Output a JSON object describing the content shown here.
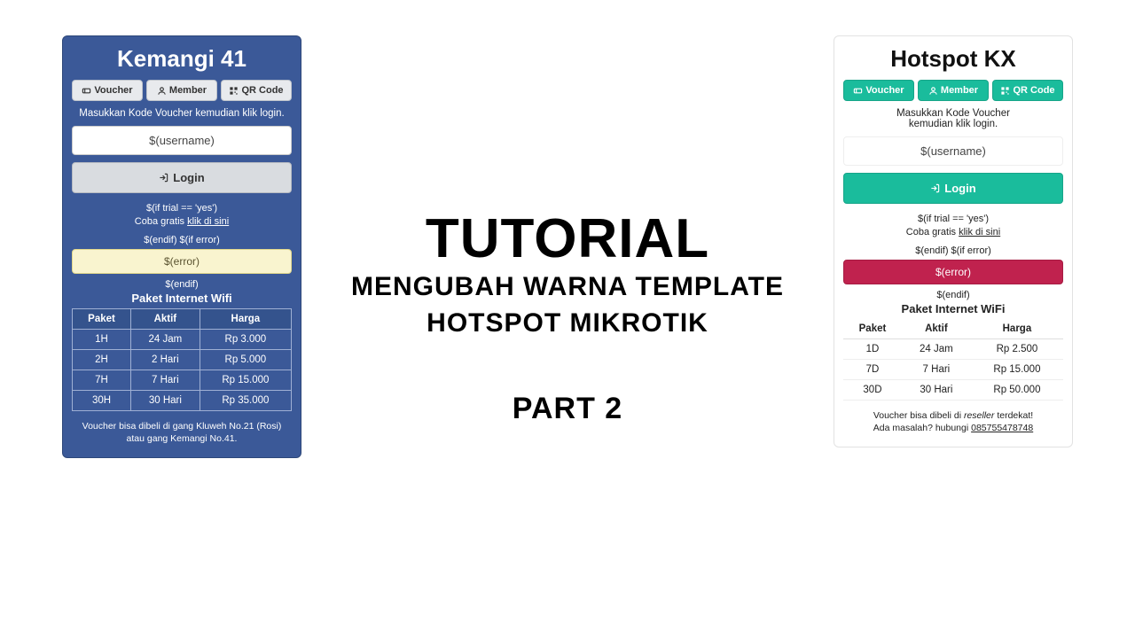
{
  "center": {
    "line1": "TUTORIAL",
    "line2a": "MENGUBAH WARNA TEMPLATE",
    "line2b": "HOTSPOT MIKROTIK",
    "line3": "PART 2"
  },
  "left": {
    "title": "Kemangi 41",
    "tabs": {
      "voucher": "Voucher",
      "member": "Member",
      "qrcode": "QR Code"
    },
    "instruction": "Masukkan Kode Voucher kemudian klik login.",
    "username_placeholder": "$(username)",
    "login": "Login",
    "trial_if": "$(if trial == 'yes')",
    "trial_text": "Coba gratis ",
    "trial_link": "klik di sini",
    "endif_iferror": "$(endif) $(if error)",
    "error": "$(error)",
    "endif": "$(endif)",
    "pkg_title": "Paket Internet Wifi",
    "pkg_headers": {
      "paket": "Paket",
      "aktif": "Aktif",
      "harga": "Harga"
    },
    "pkg_rows": [
      {
        "paket": "1H",
        "aktif": "24 Jam",
        "harga": "Rp 3.000"
      },
      {
        "paket": "2H",
        "aktif": "2 Hari",
        "harga": "Rp 5.000"
      },
      {
        "paket": "7H",
        "aktif": "7 Hari",
        "harga": "Rp 15.000"
      },
      {
        "paket": "30H",
        "aktif": "30 Hari",
        "harga": "Rp 35.000"
      }
    ],
    "footer1": "Voucher bisa dibeli di gang Kluweh No.21 (Rosi)",
    "footer2": "atau gang Kemangi No.41."
  },
  "right": {
    "title": "Hotspot KX",
    "tabs": {
      "voucher": "Voucher",
      "member": "Member",
      "qrcode": "QR Code"
    },
    "instruction1": "Masukkan Kode Voucher",
    "instruction2": "kemudian klik login.",
    "username_placeholder": "$(username)",
    "login": "Login",
    "trial_if": "$(if trial == 'yes')",
    "trial_text": "Coba gratis ",
    "trial_link": "klik di sini",
    "endif_iferror": "$(endif) $(if error)",
    "error": "$(error)",
    "endif": "$(endif)",
    "pkg_title": "Paket Internet WiFi",
    "pkg_headers": {
      "paket": "Paket",
      "aktif": "Aktif",
      "harga": "Harga"
    },
    "pkg_rows": [
      {
        "paket": "1D",
        "aktif": "24 Jam",
        "harga": "Rp 2.500"
      },
      {
        "paket": "7D",
        "aktif": "7 Hari",
        "harga": "Rp 15.000"
      },
      {
        "paket": "30D",
        "aktif": "30 Hari",
        "harga": "Rp 50.000"
      }
    ],
    "footer_a": "Voucher bisa dibeli di ",
    "footer_reseller": "reseller",
    "footer_b": " terdekat!",
    "footer2_a": "Ada masalah? hubungi ",
    "footer2_phone": "085755478748"
  }
}
